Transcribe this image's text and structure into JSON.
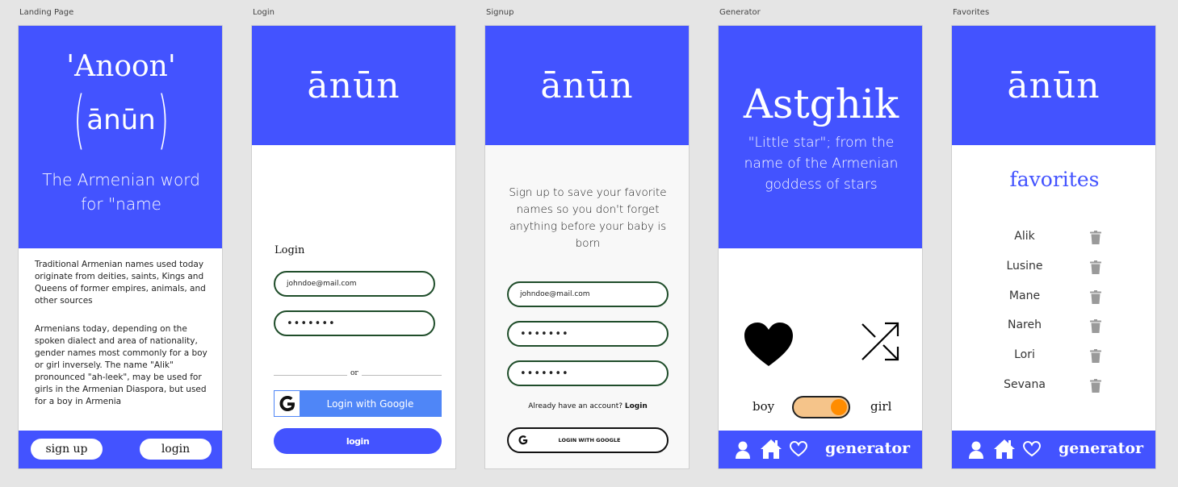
{
  "frames": {
    "landing": "Landing Page",
    "login": "Login",
    "signup": "Signup",
    "generator": "Generator",
    "favorites": "Favorites"
  },
  "landing": {
    "title": "'Anoon'",
    "phonetic": "ānūn",
    "subtitle": "The Armenian word for \"name",
    "para1": "Traditional Armenian names used today originate from deities, saints, Kings and Queens of former empires, animals, and other sources",
    "para2": "Armenians today, depending on the spoken dialect and area of nationality, gender names most commonly for a boy or girl inversely. The name \"Alik\" pronounced \"ah-leek\", may be used for girls in the Armenian Diaspora, but used for a boy in Armenia",
    "signup_label": "sign up",
    "login_label": "login"
  },
  "login": {
    "logo": "ānūn",
    "heading": "Login",
    "email": "johndoe@mail.com",
    "password": "•••••••",
    "or": "or",
    "google_label": "Login with Google",
    "submit_label": "login"
  },
  "signup": {
    "logo": "ānūn",
    "message": "Sign up to save your favorite names so you don't forget anything before your baby is born",
    "email": "johndoe@mail.com",
    "password": "•••••••",
    "password_confirm": "•••••••",
    "have_account": "Already have an account?",
    "login_link": "Login",
    "google_label": "LOGIN WITH GOOGLE"
  },
  "generator": {
    "name": "Astghik",
    "meaning": "\"Little star\"; from the name of the Armenian goddess of stars",
    "boy_label": "boy",
    "girl_label": "girl",
    "toggle_state": "girl",
    "nav_label": "generator"
  },
  "favorites": {
    "logo": "ānūn",
    "heading": "favorites",
    "names": [
      "Alik",
      "Lusine",
      "Mane",
      "Nareh",
      "Lori",
      "Sevana"
    ],
    "nav_label": "generator"
  },
  "colors": {
    "primary": "#4353ff",
    "toggle_track": "#f5c48a",
    "toggle_knob": "#ff8c00",
    "input_border": "#1f4d2a",
    "google_blue": "#4f86f7"
  }
}
